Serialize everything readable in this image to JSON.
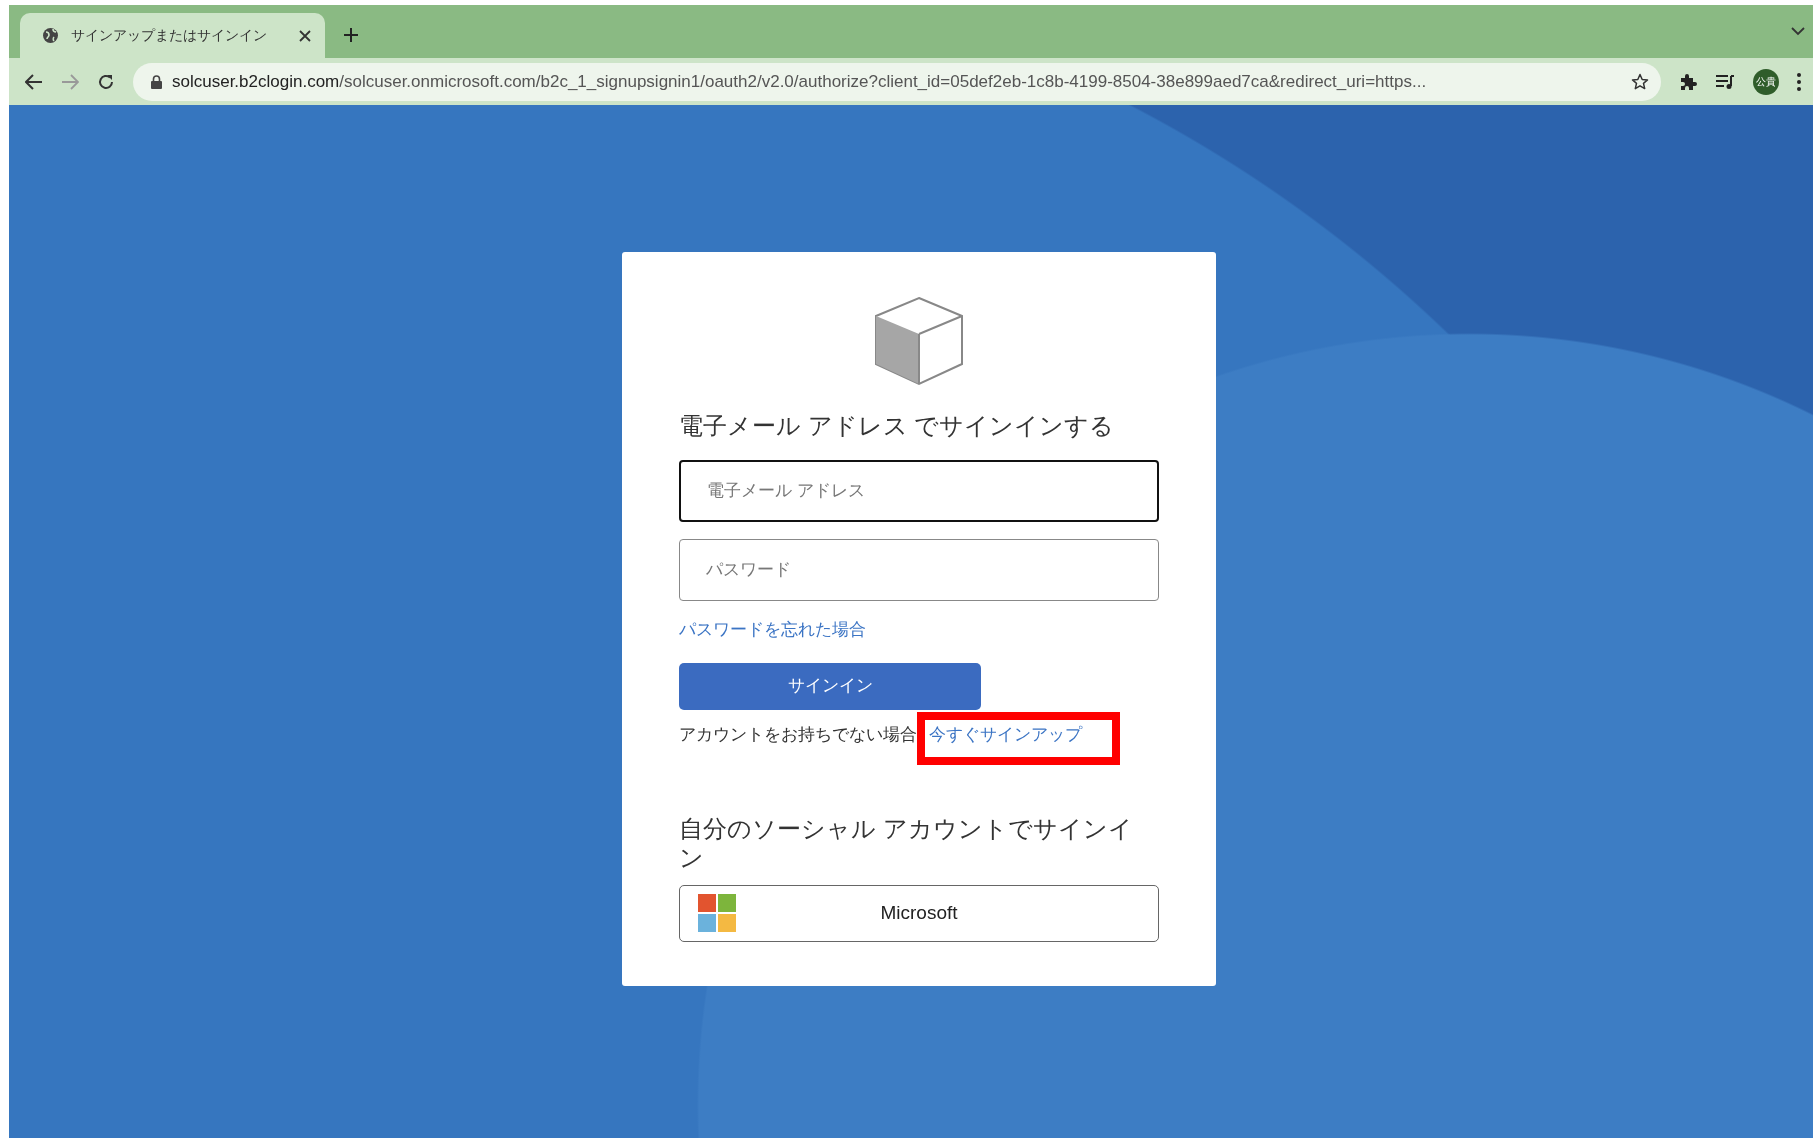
{
  "browser": {
    "tabs": [
      {
        "title": "サインアップまたはサインイン",
        "selected": true
      }
    ],
    "address": {
      "host": "solcuser.b2clogin.com",
      "path": "/solcuser.onmicrosoft.com/b2c_1_signupsignin1/oauth2/v2.0/authorize?client_id=05def2eb-1c8b-4199-8504-38e899aed7ca&redirect_uri=https..."
    },
    "profile": "公貴"
  },
  "card": {
    "heading": "電子メール アドレス でサインインする",
    "fields": [
      {
        "placeholder": "電子メール アドレス",
        "focused": true
      },
      {
        "placeholder": "パスワード",
        "focused": false
      }
    ],
    "forgot_link": "パスワードを忘れた場合",
    "signin_button": "サインイン",
    "signup_prompt": "アカウントをお持ちでない場合",
    "signup_link": {
      "label": "今すぐサインアップ",
      "highlighted": true
    },
    "social_heading": "自分のソーシャル アカウントでサインイン",
    "social_buttons": [
      {
        "label": "Microsoft"
      }
    ]
  }
}
